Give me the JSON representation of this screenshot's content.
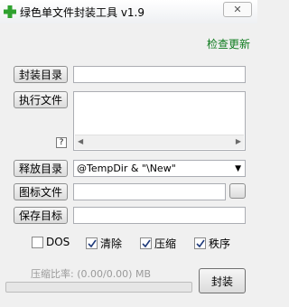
{
  "window": {
    "title": "绿色单文件封装工具 v1.9",
    "close_glyph": "✕"
  },
  "update_link": "检查更新",
  "package_dir": {
    "label": "封装目录",
    "value": ""
  },
  "exec_file": {
    "label": "执行文件",
    "value": "",
    "help": "?"
  },
  "release_dir": {
    "label": "释放目录",
    "value": "@TempDir & \"\\New\""
  },
  "icon_file": {
    "label": "图标文件",
    "value": ""
  },
  "save_target": {
    "label": "保存目标",
    "value": ""
  },
  "options": [
    {
      "label": "DOS",
      "checked": false
    },
    {
      "label": "清除",
      "checked": true
    },
    {
      "label": "压缩",
      "checked": true
    },
    {
      "label": "秩序",
      "checked": true
    }
  ],
  "compression_ratio": "压缩比率: (0.00/0.00) MB",
  "progress": 0,
  "pack_button": "封装",
  "colors": {
    "progress": "#06b025",
    "link": "#0e7b1e",
    "icon": "#2fa12f"
  },
  "icons": {
    "app": "green-plus-icon",
    "dropdown": "chevron-down-icon",
    "check": "check-icon"
  }
}
